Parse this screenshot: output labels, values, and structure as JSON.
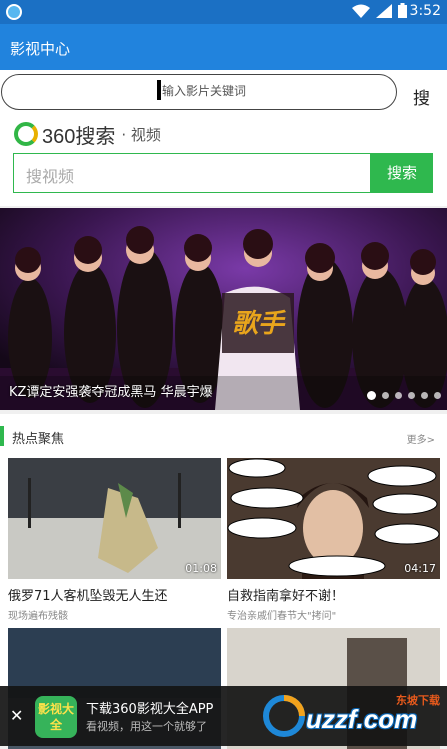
{
  "status_bar": {
    "time": "3:52"
  },
  "header": {
    "title": "影视中心"
  },
  "url_bar": {
    "placeholder": "输入影片关键词",
    "go_label": "搜"
  },
  "search": {
    "logo_name": "360搜索",
    "logo_sub": "· 视频",
    "placeholder": "搜视频",
    "button_label": "搜索"
  },
  "banner": {
    "caption": "KZ谭定安强袭夺冠成黑马 华晨宇爆",
    "slide_count": 6,
    "active_slide": 1
  },
  "hot": {
    "title": "热点聚焦",
    "more": "更多>",
    "videos": [
      {
        "title": "俄罗71人客机坠毁无人生还",
        "subtitle": "现场遍布残骸",
        "duration": "01:08"
      },
      {
        "title": "自救指南拿好不谢！",
        "subtitle": "专治亲戚们春节大\"拷问\"",
        "duration": "04:17"
      }
    ]
  },
  "ad": {
    "app_icon_text": "影视大全",
    "line1": "下载360影视大全APP",
    "line2": "看视频，用这一个就够了"
  },
  "watermark": {
    "top": "东坡下载",
    "main": "uzzf.com"
  }
}
